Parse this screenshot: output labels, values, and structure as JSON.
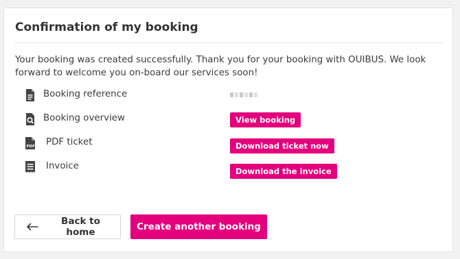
{
  "card": {
    "title": "Confirmation of my booking",
    "intro": "Your booking was created successfully. Thank you for your booking with OUIBUS. We look forward to welcome you on-board our services soon!"
  },
  "rows": [
    {
      "label": "Booking reference",
      "icon": "document-icon",
      "value": ""
    },
    {
      "label": "Booking overview",
      "icon": "search-document-icon",
      "action": "View booking"
    },
    {
      "label": "PDF ticket",
      "icon": "pdf-file-icon",
      "action": "Download ticket now"
    },
    {
      "label": "Invoice",
      "icon": "receipt-icon",
      "action": "Download the invoice"
    }
  ],
  "buttons": {
    "back": "Back to home",
    "create": "Create another booking"
  },
  "colors": {
    "accent": "#e4007c",
    "text": "#3b3b3b",
    "icon": "#444444"
  }
}
